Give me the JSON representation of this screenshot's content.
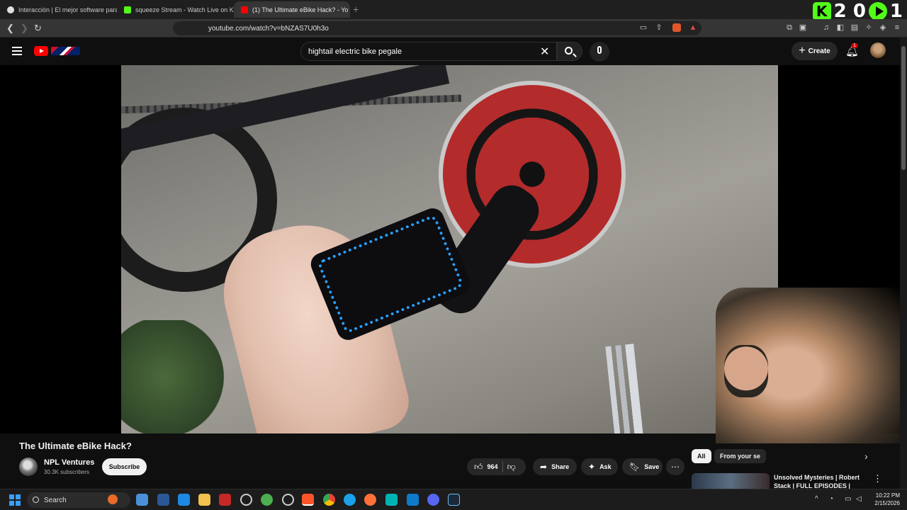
{
  "browser": {
    "tabs": [
      {
        "label": "Interacción | El mejor software para g",
        "favicon_color": "#e0e0e0"
      },
      {
        "label": "squeeze Stream - Watch Live on Kick",
        "favicon_color": "#53fc18"
      },
      {
        "label": "(1) The Ultimate eBike Hack? - Yo",
        "favicon_color": "#ff0000",
        "active": true
      }
    ],
    "url": "youtube.com/watch?v=bNZAS7U0h3o",
    "overlay_counter": {
      "left": "2 0",
      "right": "1"
    }
  },
  "youtube": {
    "search_query": "hightail electric bike pegale",
    "create_label": "Create",
    "notification_count": "1"
  },
  "video": {
    "title": "The Ultimate eBike Hack?",
    "channel_name": "NPL Ventures",
    "subscribers": "30.3K subscribers",
    "subscribe_label": "Subscribe",
    "likes": "964",
    "share_label": "Share",
    "ask_label": "Ask",
    "save_label": "Save"
  },
  "sidebar": {
    "chips": [
      "All",
      "From your se"
    ],
    "recommendation_title": "Unsolved Mysteries | Robert Stack | FULL EPISODES |"
  },
  "taskbar": {
    "search_label": "Search",
    "time": "10:22 PM",
    "date": "2/15/2026"
  },
  "colors": {
    "accent": "#ff0000",
    "kick_green": "#53fc18",
    "background": "#0f0f0f"
  }
}
